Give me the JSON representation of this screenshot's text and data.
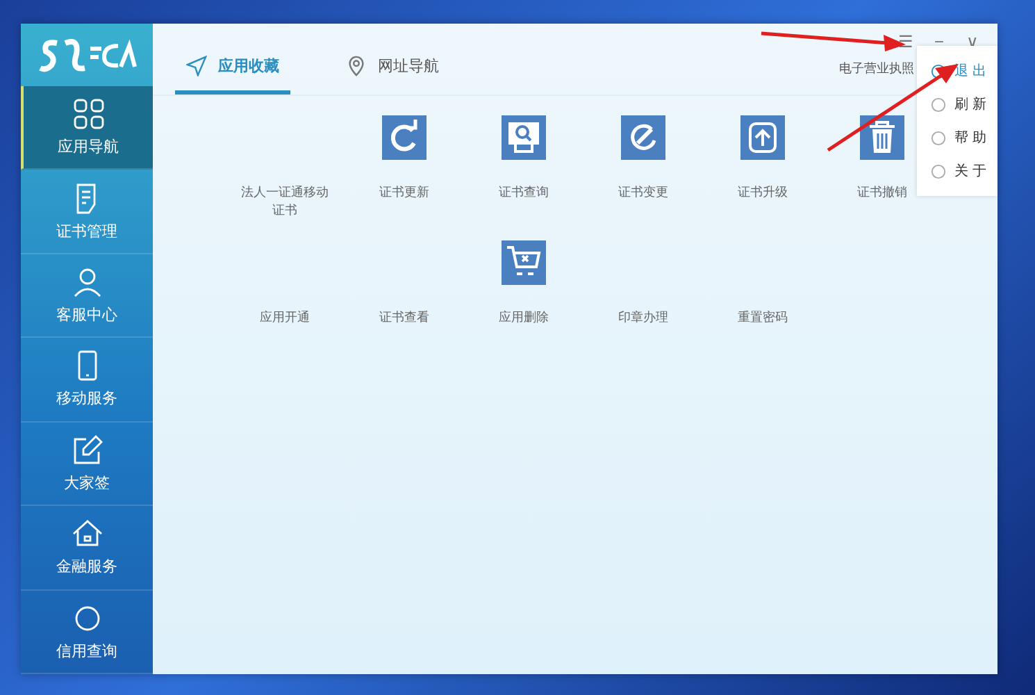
{
  "sidebar": {
    "items": [
      {
        "label": "应用导航",
        "kind": "grid",
        "selected": true
      },
      {
        "label": "证书管理",
        "kind": "document",
        "selected": false
      },
      {
        "label": "客服中心",
        "kind": "person",
        "selected": false
      },
      {
        "label": "移动服务",
        "kind": "phone",
        "selected": false
      },
      {
        "label": "大家签",
        "kind": "pen",
        "selected": false
      },
      {
        "label": "金融服务",
        "kind": "house",
        "selected": false
      },
      {
        "label": "信用查询",
        "kind": "circle",
        "selected": false
      }
    ]
  },
  "window": {
    "controls": [
      "☰",
      "−",
      "∨"
    ]
  },
  "tabs": [
    {
      "label": "应用收藏",
      "kind": "send",
      "selected": true
    },
    {
      "label": "网址导航",
      "kind": "pin",
      "selected": false
    }
  ],
  "header_text": "电子营业执照",
  "apps": [
    [
      {
        "label": "法人一证通移动证书",
        "kind": "none"
      },
      {
        "label": "证书更新",
        "kind": "refresh"
      },
      {
        "label": "证书查询",
        "kind": "search"
      },
      {
        "label": "证书变更",
        "kind": "edit"
      },
      {
        "label": "证书升级",
        "kind": "upload"
      },
      {
        "label": "证书撤销",
        "kind": "trash"
      }
    ],
    [
      {
        "label": "应用开通",
        "kind": "none"
      },
      {
        "label": "证书查看",
        "kind": "none"
      },
      {
        "label": "应用删除",
        "kind": "cart"
      },
      {
        "label": "印章办理",
        "kind": "none"
      },
      {
        "label": "重置密码",
        "kind": "none"
      }
    ]
  ],
  "menu": [
    {
      "label": "退 出",
      "selected": true
    },
    {
      "label": "刷 新",
      "selected": false
    },
    {
      "label": "帮 助",
      "selected": false
    },
    {
      "label": "关 于",
      "selected": false
    }
  ]
}
